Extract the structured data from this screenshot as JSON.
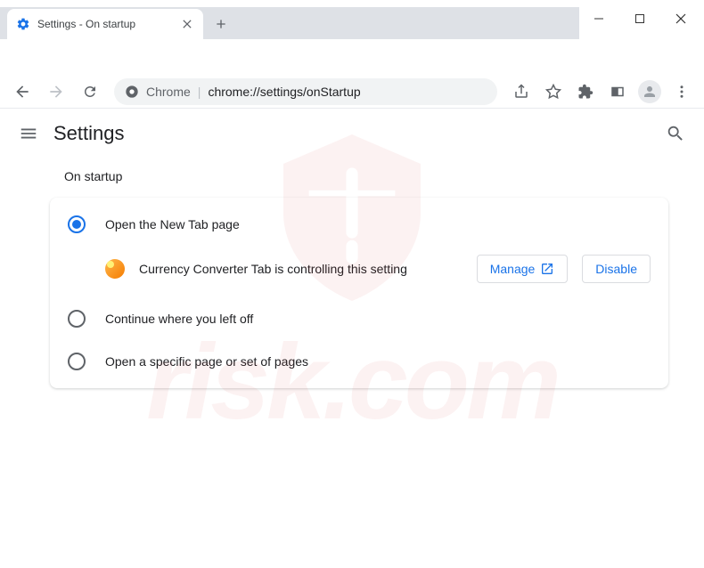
{
  "window": {
    "tab_title": "Settings - On startup"
  },
  "toolbar": {
    "origin": "Chrome",
    "path": "chrome://settings/onStartup"
  },
  "header": {
    "title": "Settings"
  },
  "section": {
    "title": "On startup",
    "options": [
      {
        "label": "Open the New Tab page",
        "checked": true
      },
      {
        "label": "Continue where you left off",
        "checked": false
      },
      {
        "label": "Open a specific page or set of pages",
        "checked": false
      }
    ],
    "extension": {
      "message": "Currency Converter Tab is controlling this setting",
      "manage_label": "Manage",
      "disable_label": "Disable"
    }
  },
  "watermark": {
    "text": "risk.com"
  }
}
